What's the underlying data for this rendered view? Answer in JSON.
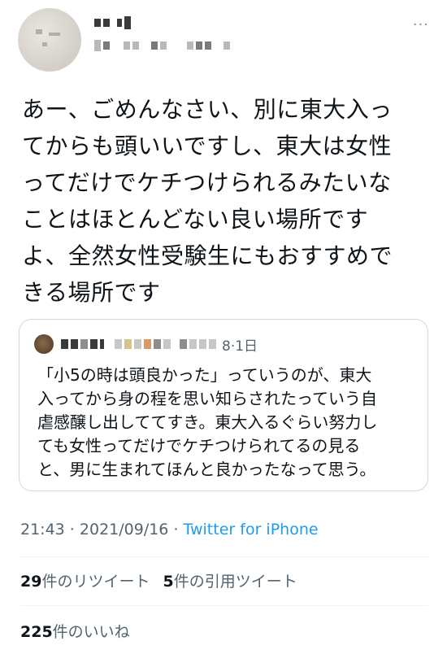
{
  "tweet": {
    "text": "あー、ごめんなさい、別に東大入っ\nてからも頭いいですし、東大は女性\nってだけでケチつけられるみたいな\nことはほとんどない良い場所です\nよ、全然女性受験生にもおすすめで\nきる場所です",
    "more_label": "···"
  },
  "quote": {
    "date": "8·1日",
    "text": "「小5の時は頭良かった」っていうのが、東大\n入ってから身の程を思い知らされたっていう自\n虐感醸し出しててすき。東大入るぐらい努力し\nても女性ってだけでケチつけられてるの見る\nと、男に生まれてほんと良かったなって思う。"
  },
  "meta": {
    "time": "21:43",
    "sep1": " · ",
    "date": "2021/09/16",
    "sep2": " · ",
    "source": "Twitter for iPhone"
  },
  "stats": {
    "retweets_count": "29",
    "retweets_label": "件のリツイート",
    "quotes_count": "5",
    "quotes_label": "件の引用ツイート",
    "likes_count": "225",
    "likes_label": "件のいいね"
  }
}
